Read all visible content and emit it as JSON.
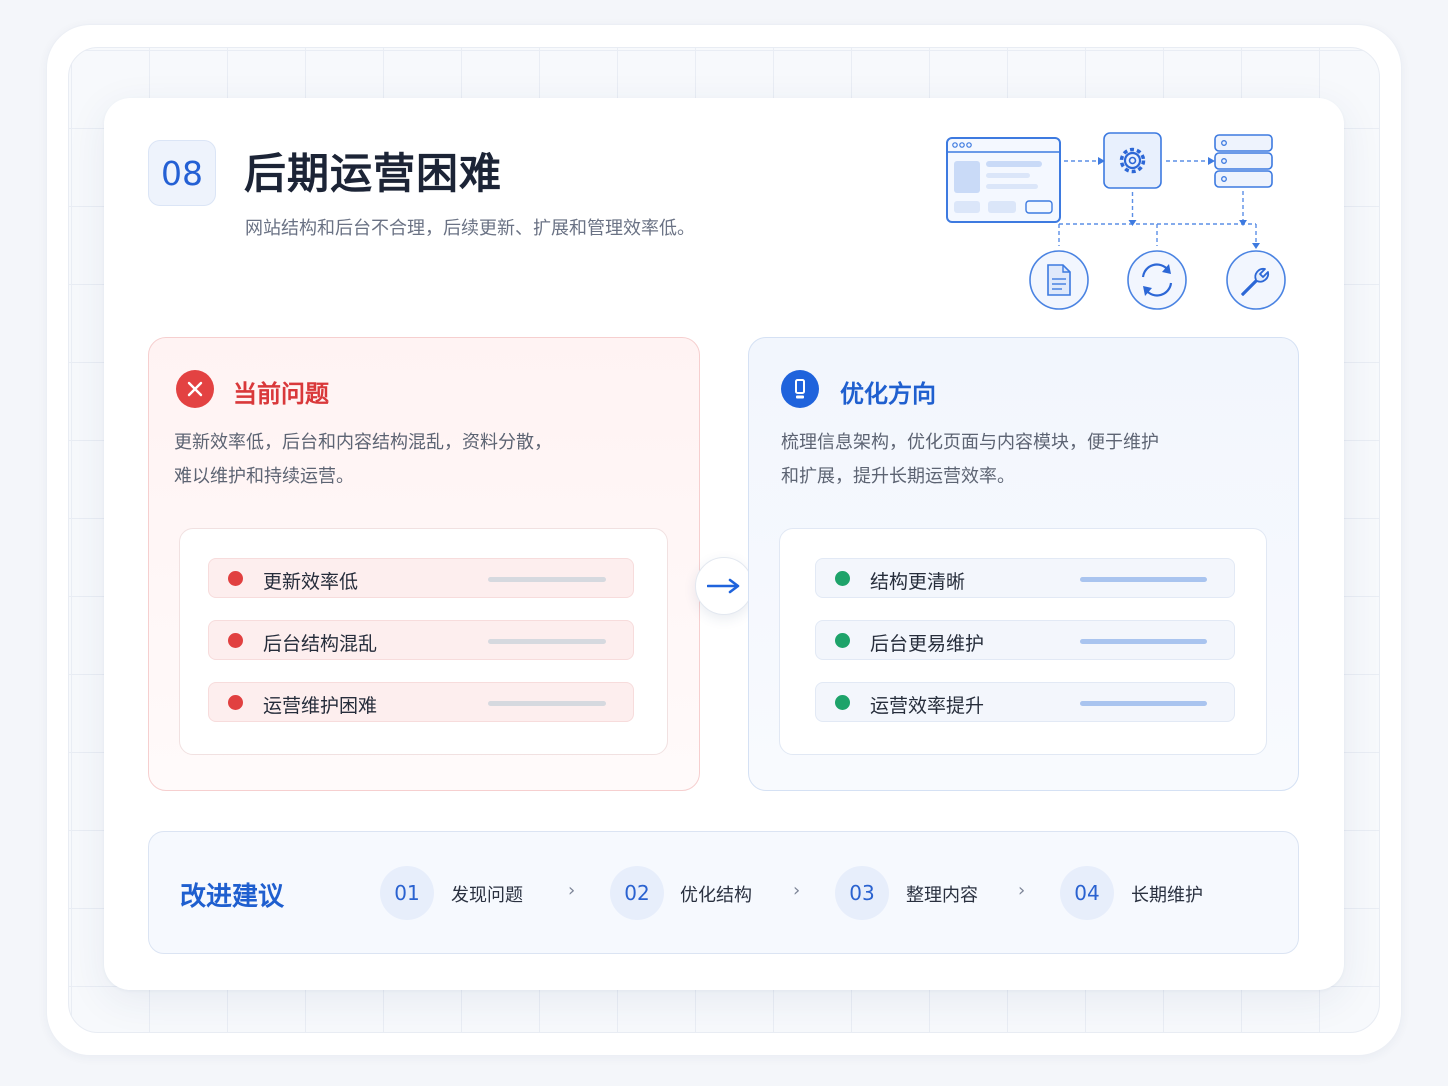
{
  "header": {
    "number": "08",
    "title": "后期运营困难",
    "subtitle": "网站结构和后台不合理，后续更新、扩展和管理效率低。"
  },
  "problem": {
    "title": "当前问题",
    "desc_line1": "更新效率低，后台和内容结构混乱，资料分散，",
    "desc_line2": "难以维护和持续运营。",
    "items": [
      {
        "label": "更新效率低"
      },
      {
        "label": "后台结构混乱"
      },
      {
        "label": "运营维护困难"
      }
    ]
  },
  "solution": {
    "title": "优化方向",
    "desc_line1": "梳理信息架构，优化页面与内容模块，便于维护",
    "desc_line2": "和扩展，提升长期运营效率。",
    "items": [
      {
        "label": "结构更清晰"
      },
      {
        "label": "后台更易维护"
      },
      {
        "label": "运营效率提升"
      }
    ]
  },
  "suggest": {
    "title": "改进建议",
    "steps": [
      {
        "num": "01",
        "label": "发现问题"
      },
      {
        "num": "02",
        "label": "优化结构"
      },
      {
        "num": "03",
        "label": "整理内容"
      },
      {
        "num": "04",
        "label": "长期维护"
      }
    ]
  },
  "icons": {
    "problem": "close-circle-icon",
    "solution": "exclamation-icon",
    "arrow": "arrow-right-icon",
    "illustration": [
      "browser-window-icon",
      "gear-icon",
      "server-stack-icon",
      "document-icon",
      "refresh-icon",
      "wrench-icon"
    ]
  },
  "colors": {
    "accent_blue": "#1f63dc",
    "problem_red": "#e34242",
    "success_green": "#1ea36a"
  }
}
